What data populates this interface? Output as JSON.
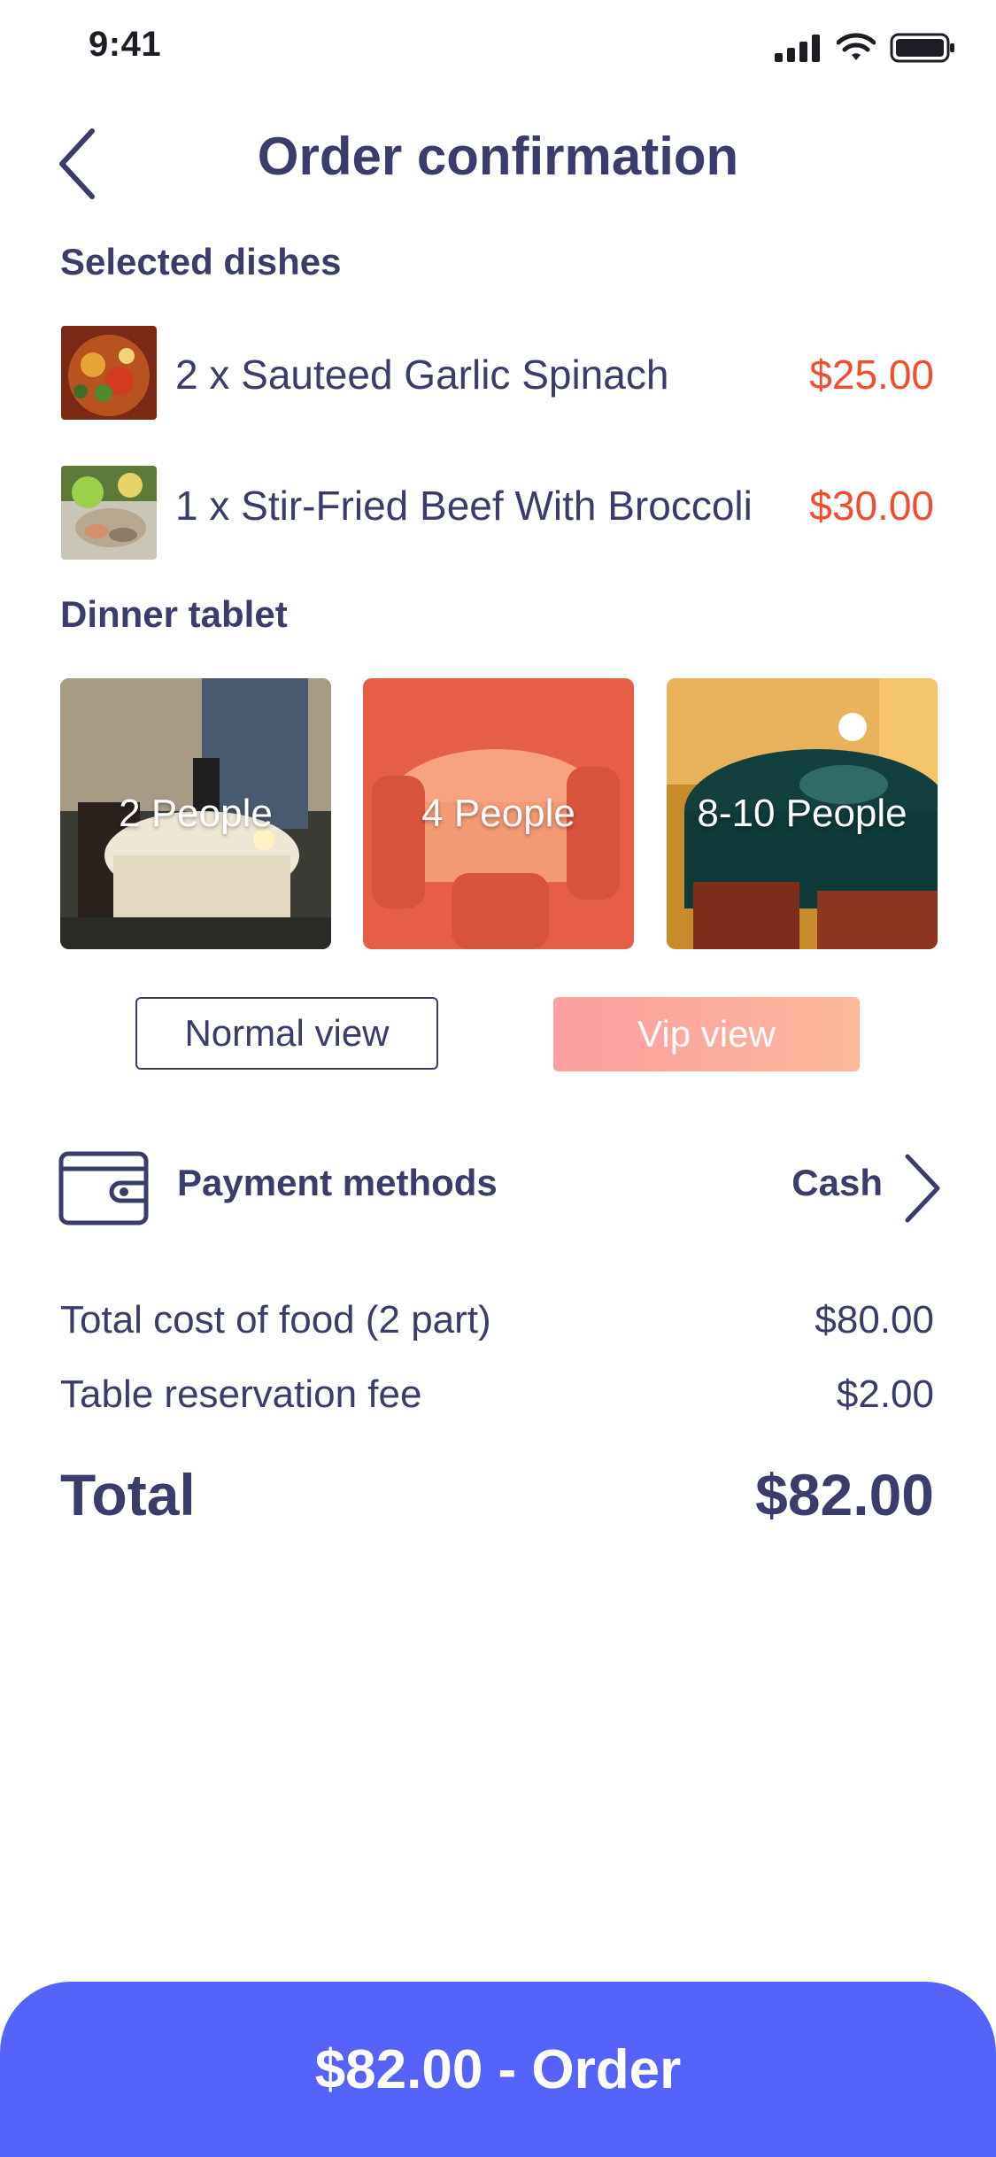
{
  "status_bar": {
    "time": "9:41"
  },
  "header": {
    "title": "Order confirmation"
  },
  "dishes": {
    "label": "Selected dishes",
    "items": [
      {
        "name": "2 x Sauteed Garlic Spinach",
        "price": "$25.00"
      },
      {
        "name": "1 x Stir-Fried Beef With Broccoli",
        "price": "$30.00"
      }
    ]
  },
  "tables": {
    "label": "Dinner tablet",
    "items": [
      {
        "label": "2 People"
      },
      {
        "label": "4 People"
      },
      {
        "label": "8-10 People"
      }
    ]
  },
  "views": {
    "normal": "Normal view",
    "vip": "Vip view"
  },
  "payment": {
    "label": "Payment methods",
    "value": "Cash"
  },
  "summary": {
    "food_label": "Total cost of food (2 part)",
    "food_value": "$80.00",
    "fee_label": "Table reservation fee",
    "fee_value": "$2.00",
    "total_label": "Total",
    "total_value": "$82.00"
  },
  "order_button": {
    "label": "$82.00 - Order"
  },
  "colors": {
    "text": "#3a3d6b",
    "price": "#f24e2e",
    "order_bar": "#5563fa",
    "vip_gradient": [
      "#fb9ea0",
      "#fdb89a"
    ]
  }
}
